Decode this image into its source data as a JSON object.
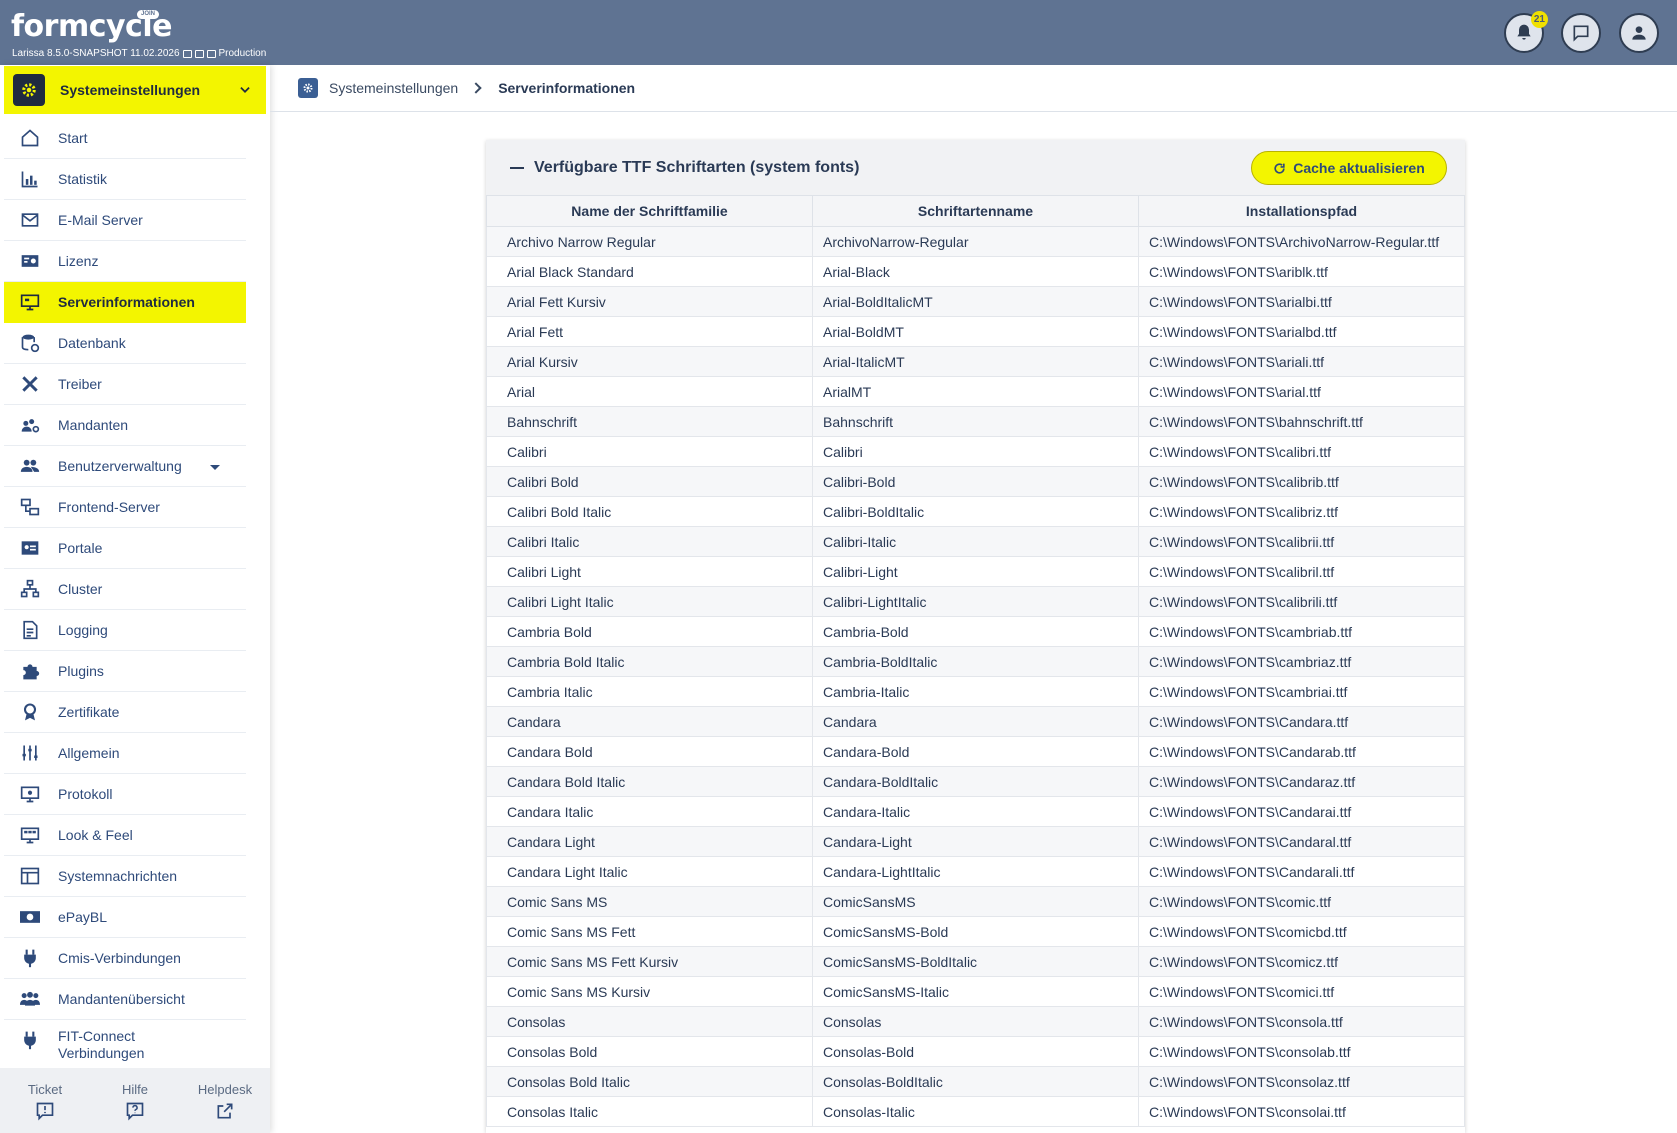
{
  "app": {
    "logo": "formcycle",
    "logo_badge": "JOIN",
    "build_info": "Larissa 8.5.0-SNAPSHOT 11.02.2026",
    "environment": "Production",
    "notification_count": "21"
  },
  "sidebar": {
    "module_label": "Systemeinstellungen",
    "items": [
      {
        "label": "Start",
        "icon": "home-icon"
      },
      {
        "label": "Statistik",
        "icon": "bar-chart-icon"
      },
      {
        "label": "E-Mail Server",
        "icon": "envelope-icon"
      },
      {
        "label": "Lizenz",
        "icon": "license-icon"
      },
      {
        "label": "Serverinformationen",
        "icon": "monitor-icon"
      },
      {
        "label": "Datenbank",
        "icon": "database-icon"
      },
      {
        "label": "Treiber",
        "icon": "tools-icon"
      },
      {
        "label": "Mandanten",
        "icon": "users-gear-icon"
      },
      {
        "label": "Benutzerverwaltung",
        "icon": "user-group-icon"
      },
      {
        "label": "Frontend-Server",
        "icon": "network-icon"
      },
      {
        "label": "Portale",
        "icon": "portal-icon"
      },
      {
        "label": "Cluster",
        "icon": "cluster-icon"
      },
      {
        "label": "Logging",
        "icon": "document-icon"
      },
      {
        "label": "Plugins",
        "icon": "puzzle-icon"
      },
      {
        "label": "Zertifikate",
        "icon": "certificate-icon"
      },
      {
        "label": "Allgemein",
        "icon": "sliders-icon"
      },
      {
        "label": "Protokoll",
        "icon": "protocol-icon"
      },
      {
        "label": "Look & Feel",
        "icon": "palette-monitor-icon"
      },
      {
        "label": "Systemnachrichten",
        "icon": "message-board-icon"
      },
      {
        "label": "ePayBL",
        "icon": "money-icon"
      },
      {
        "label": "Cmis-Verbindungen",
        "icon": "plug-icon"
      },
      {
        "label": "Mandantenübersicht",
        "icon": "users-icon"
      },
      {
        "label": "FIT-Connect Verbindungen",
        "icon": "plug-icon"
      }
    ],
    "footer": [
      {
        "label": "Ticket",
        "icon": "ticket-icon"
      },
      {
        "label": "Hilfe",
        "icon": "help-icon"
      },
      {
        "label": "Helpdesk",
        "icon": "external-link-icon"
      }
    ]
  },
  "breadcrumb": {
    "parent": "Systemeinstellungen",
    "current": "Serverinformationen"
  },
  "panel": {
    "title": "Verfügbare TTF Schriftarten (system fonts)",
    "cache_button": "Cache aktualisieren",
    "columns": [
      "Name der Schriftfamilie",
      "Schriftartenname",
      "Installationspfad"
    ],
    "rows": [
      [
        "Archivo Narrow Regular",
        "ArchivoNarrow-Regular",
        "C:\\Windows\\FONTS\\ArchivoNarrow-Regular.ttf"
      ],
      [
        "Arial Black Standard",
        "Arial-Black",
        "C:\\Windows\\FONTS\\ariblk.ttf"
      ],
      [
        "Arial Fett Kursiv",
        "Arial-BoldItalicMT",
        "C:\\Windows\\FONTS\\arialbi.ttf"
      ],
      [
        "Arial Fett",
        "Arial-BoldMT",
        "C:\\Windows\\FONTS\\arialbd.ttf"
      ],
      [
        "Arial Kursiv",
        "Arial-ItalicMT",
        "C:\\Windows\\FONTS\\ariali.ttf"
      ],
      [
        "Arial",
        "ArialMT",
        "C:\\Windows\\FONTS\\arial.ttf"
      ],
      [
        "Bahnschrift",
        "Bahnschrift",
        "C:\\Windows\\FONTS\\bahnschrift.ttf"
      ],
      [
        "Calibri",
        "Calibri",
        "C:\\Windows\\FONTS\\calibri.ttf"
      ],
      [
        "Calibri Bold",
        "Calibri-Bold",
        "C:\\Windows\\FONTS\\calibrib.ttf"
      ],
      [
        "Calibri Bold Italic",
        "Calibri-BoldItalic",
        "C:\\Windows\\FONTS\\calibriz.ttf"
      ],
      [
        "Calibri Italic",
        "Calibri-Italic",
        "C:\\Windows\\FONTS\\calibrii.ttf"
      ],
      [
        "Calibri Light",
        "Calibri-Light",
        "C:\\Windows\\FONTS\\calibril.ttf"
      ],
      [
        "Calibri Light Italic",
        "Calibri-LightItalic",
        "C:\\Windows\\FONTS\\calibrili.ttf"
      ],
      [
        "Cambria Bold",
        "Cambria-Bold",
        "C:\\Windows\\FONTS\\cambriab.ttf"
      ],
      [
        "Cambria Bold Italic",
        "Cambria-BoldItalic",
        "C:\\Windows\\FONTS\\cambriaz.ttf"
      ],
      [
        "Cambria Italic",
        "Cambria-Italic",
        "C:\\Windows\\FONTS\\cambriai.ttf"
      ],
      [
        "Candara",
        "Candara",
        "C:\\Windows\\FONTS\\Candara.ttf"
      ],
      [
        "Candara Bold",
        "Candara-Bold",
        "C:\\Windows\\FONTS\\Candarab.ttf"
      ],
      [
        "Candara Bold Italic",
        "Candara-BoldItalic",
        "C:\\Windows\\FONTS\\Candaraz.ttf"
      ],
      [
        "Candara Italic",
        "Candara-Italic",
        "C:\\Windows\\FONTS\\Candarai.ttf"
      ],
      [
        "Candara Light",
        "Candara-Light",
        "C:\\Windows\\FONTS\\Candaral.ttf"
      ],
      [
        "Candara Light Italic",
        "Candara-LightItalic",
        "C:\\Windows\\FONTS\\Candarali.ttf"
      ],
      [
        "Comic Sans MS",
        "ComicSansMS",
        "C:\\Windows\\FONTS\\comic.ttf"
      ],
      [
        "Comic Sans MS Fett",
        "ComicSansMS-Bold",
        "C:\\Windows\\FONTS\\comicbd.ttf"
      ],
      [
        "Comic Sans MS Fett Kursiv",
        "ComicSansMS-BoldItalic",
        "C:\\Windows\\FONTS\\comicz.ttf"
      ],
      [
        "Comic Sans MS Kursiv",
        "ComicSansMS-Italic",
        "C:\\Windows\\FONTS\\comici.ttf"
      ],
      [
        "Consolas",
        "Consolas",
        "C:\\Windows\\FONTS\\consola.ttf"
      ],
      [
        "Consolas Bold",
        "Consolas-Bold",
        "C:\\Windows\\FONTS\\consolab.ttf"
      ],
      [
        "Consolas Bold Italic",
        "Consolas-BoldItalic",
        "C:\\Windows\\FONTS\\consolaz.ttf"
      ],
      [
        "Consolas Italic",
        "Consolas-Italic",
        "C:\\Windows\\FONTS\\consolai.ttf"
      ]
    ]
  },
  "colors": {
    "topbar": "#5f7392",
    "highlight": "#f3f500",
    "text": "#2a3a55",
    "nav_text": "#2e4a7a"
  }
}
